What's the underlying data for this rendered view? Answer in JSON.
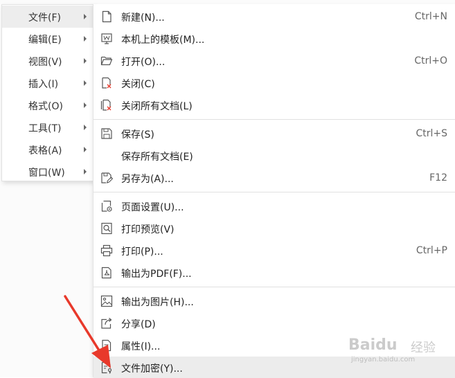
{
  "main_menu": {
    "items": [
      {
        "label": "文件(F)",
        "active": true
      },
      {
        "label": "编辑(E)"
      },
      {
        "label": "视图(V)"
      },
      {
        "label": "插入(I)"
      },
      {
        "label": "格式(O)"
      },
      {
        "label": "工具(T)"
      },
      {
        "label": "表格(A)"
      },
      {
        "label": "窗口(W)"
      }
    ]
  },
  "file_menu": {
    "items": [
      {
        "label": "新建(N)...",
        "shortcut": "Ctrl+N",
        "icon": "new-document-icon"
      },
      {
        "label": "本机上的模板(M)...",
        "shortcut": "",
        "icon": "template-icon"
      },
      {
        "label": "打开(O)...",
        "shortcut": "Ctrl+O",
        "icon": "open-folder-icon"
      },
      {
        "label": "关闭(C)",
        "shortcut": "",
        "icon": "close-document-icon"
      },
      {
        "label": "关闭所有文档(L)",
        "shortcut": "",
        "icon": "close-all-documents-icon"
      },
      {
        "label": "保存(S)",
        "shortcut": "Ctrl+S",
        "icon": "save-icon"
      },
      {
        "label": "保存所有文档(E)",
        "shortcut": "",
        "icon": ""
      },
      {
        "label": "另存为(A)...",
        "shortcut": "F12",
        "icon": "save-as-icon"
      },
      {
        "label": "页面设置(U)...",
        "shortcut": "",
        "icon": "page-setup-icon"
      },
      {
        "label": "打印预览(V)",
        "shortcut": "",
        "icon": "print-preview-icon"
      },
      {
        "label": "打印(P)...",
        "shortcut": "Ctrl+P",
        "icon": "printer-icon"
      },
      {
        "label": "输出为PDF(F)...",
        "shortcut": "",
        "icon": "export-pdf-icon"
      },
      {
        "label": "输出为图片(H)...",
        "shortcut": "",
        "icon": "export-image-icon"
      },
      {
        "label": "分享(D)",
        "shortcut": "",
        "icon": "share-icon"
      },
      {
        "label": "属性(I)...",
        "shortcut": "",
        "icon": "properties-icon"
      },
      {
        "label": "文件加密(Y)...",
        "shortcut": "",
        "icon": "file-encrypt-icon",
        "active": true
      }
    ]
  },
  "annotation": {
    "color": "#e8392b",
    "icon": "red-arrow"
  },
  "watermark": {
    "brand": "Baidu",
    "sub": "经验",
    "url": "jingyan.baidu.com"
  }
}
